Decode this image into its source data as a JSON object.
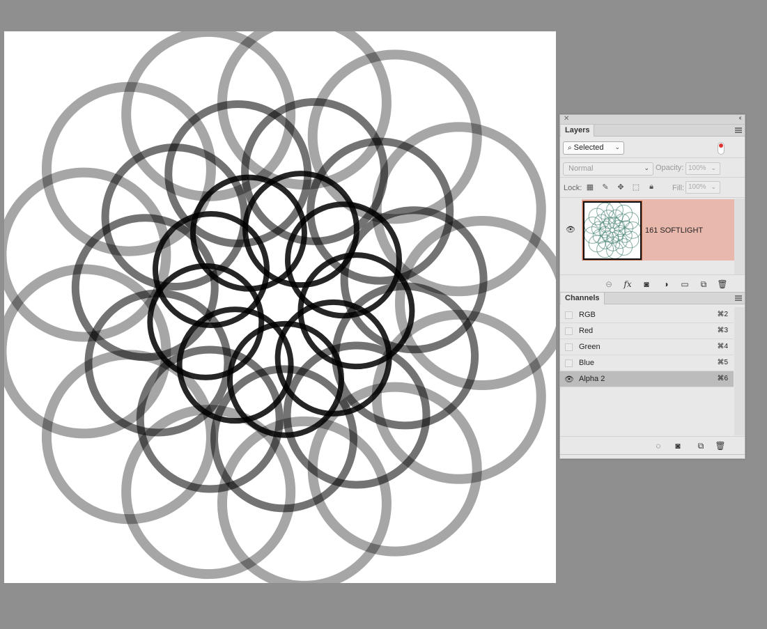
{
  "layers_panel": {
    "tab_label": "Layers",
    "filter": {
      "selected": "Selected",
      "active_indicator_color": "#dd3333"
    },
    "blend_mode": "Normal",
    "opacity_label": "Opacity:",
    "opacity_value": "100%",
    "lock_label": "Lock:",
    "fill_label": "Fill:",
    "fill_value": "100%",
    "layers": [
      {
        "name": "161 SOFTLIGHT",
        "visible": true,
        "selected": true,
        "highlight_color": "#e9b8ad"
      }
    ],
    "bottom_icons": [
      "link-icon",
      "fx-icon",
      "mask-icon",
      "adjustment-icon",
      "folder-icon",
      "new-layer-icon",
      "trash-icon"
    ],
    "fx_label": "fx"
  },
  "channels_panel": {
    "tab_label": "Channels",
    "channels": [
      {
        "name": "RGB",
        "shortcut": "⌘2",
        "visible": false
      },
      {
        "name": "Red",
        "shortcut": "⌘3",
        "visible": false
      },
      {
        "name": "Green",
        "shortcut": "⌘4",
        "visible": false
      },
      {
        "name": "Blue",
        "shortcut": "⌘5",
        "visible": false
      },
      {
        "name": "Alpha 2",
        "shortcut": "⌘6",
        "visible": true,
        "selected": true
      }
    ],
    "bottom_icons": [
      "selection-from-channel-icon",
      "save-selection-icon",
      "new-channel-icon",
      "trash-icon"
    ]
  },
  "colors": {
    "workspace": "#8f8f8f",
    "canvas": "#ffffff",
    "panel": "#e8e8e8",
    "selected_layer": "#e9b8ad",
    "selected_channel": "#bcbcbc"
  }
}
